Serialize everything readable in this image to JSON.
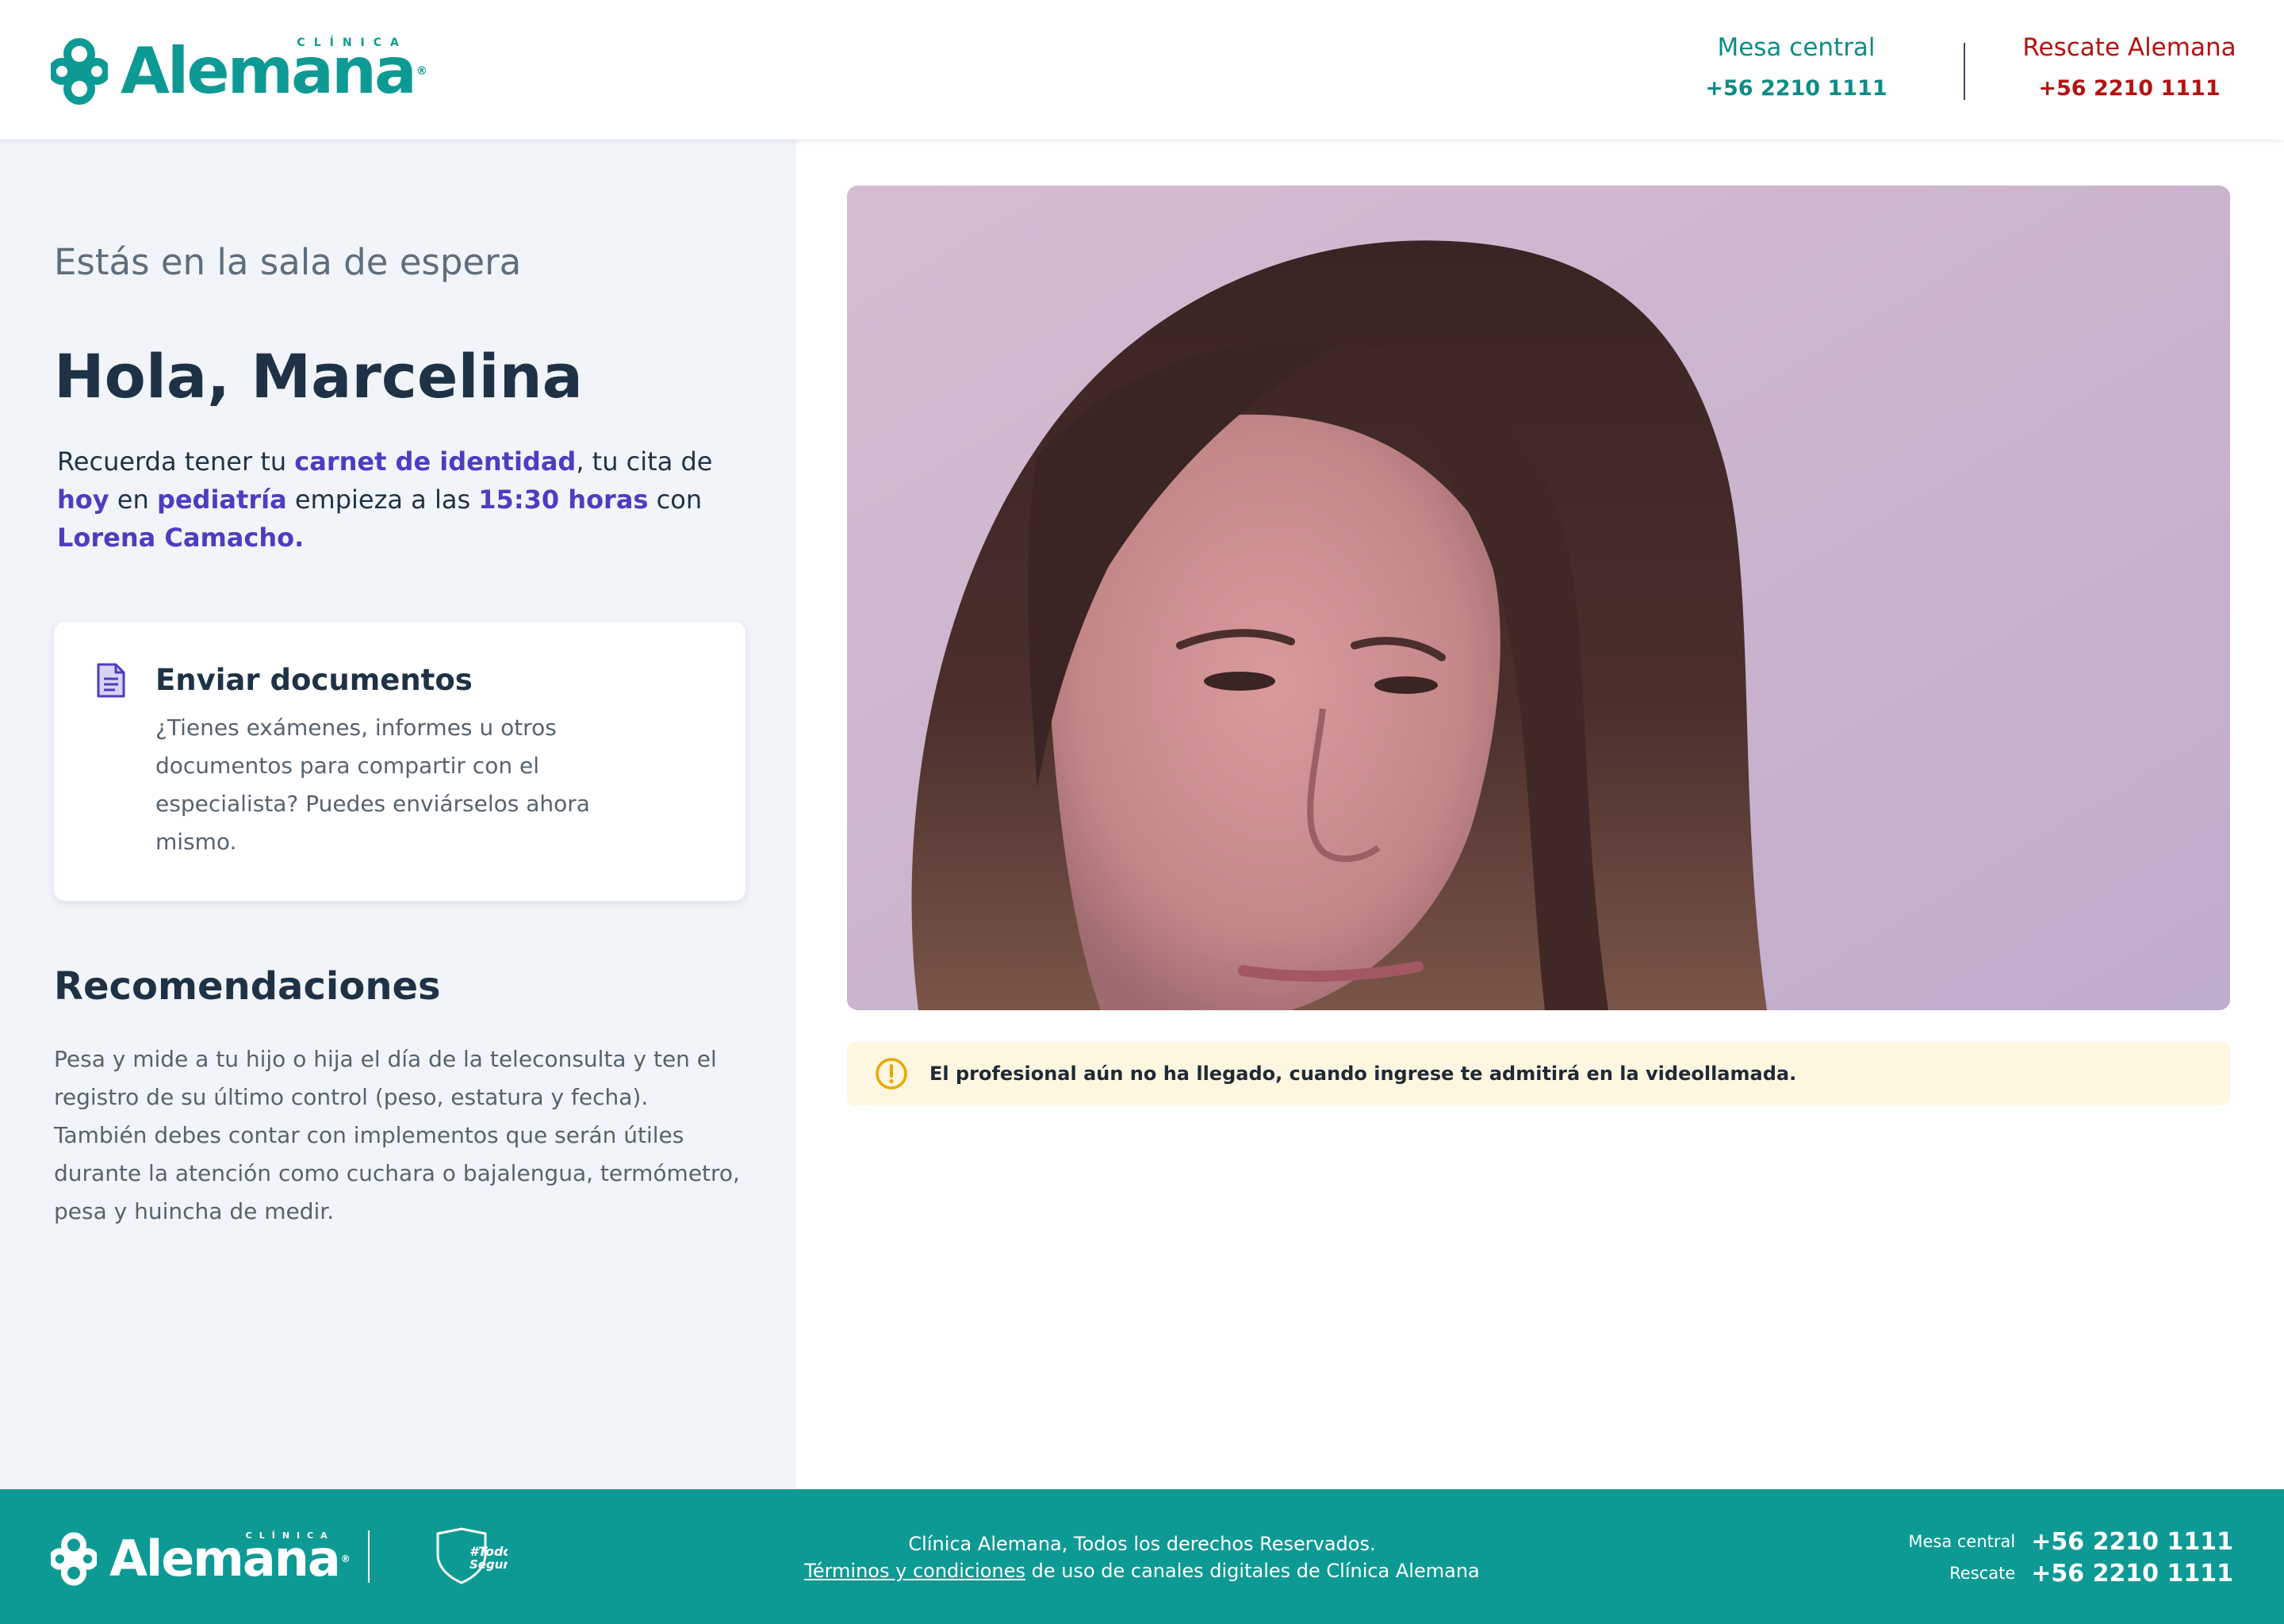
{
  "brand": {
    "name": "Alemana",
    "tagline": "CLÍNICA",
    "registered": "®",
    "teal": "#0e9a94",
    "red": "#b41212",
    "purple": "#4b3ec2"
  },
  "header": {
    "central_label": "Mesa central",
    "central_number": "+56 2210 1111",
    "rescue_label": "Rescate Alemana",
    "rescue_number": "+56 2210 1111"
  },
  "waiting_room": {
    "subtitle": "Estás en la sala de espera",
    "greeting": "Hola, Marcelina",
    "reminder": {
      "p1": "Recuerda tener tu ",
      "document": "carnet de identidad",
      "p2": ", tu cita de ",
      "day": "hoy",
      "p3": " en ",
      "specialty": "pediatría",
      "p4": " empieza a las ",
      "time": "15:30 horas",
      "p5": " con ",
      "doctor": "Lorena Camacho."
    }
  },
  "documents_card": {
    "icon": "document-icon",
    "title": "Enviar documentos",
    "description": "¿Tienes exámenes, informes u otros documentos para compartir con el especialista? Puedes enviárselos ahora mismo."
  },
  "recommendations": {
    "title": "Recomendaciones",
    "text": "Pesa y mide a tu hijo o hija el día de la teleconsulta y ten el registro de su último control (peso, estatura y fecha). También debes contar con implementos que serán útiles durante la atención como cuchara o bajalengua, termómetro, pesa y huincha de medir."
  },
  "video": {
    "icon": "camera-feed"
  },
  "notice": {
    "icon": "warning-circle-icon",
    "text": "El profesional aún no ha llegado, cuando ingrese te admitirá en la videollamada."
  },
  "footer": {
    "badge_line1": "#Todos",
    "badge_line2": "Seguros",
    "rights": "Clínica Alemana, Todos los derechos Reservados.",
    "terms_link": "Términos y condiciones",
    "terms_rest": " de uso de canales digitales de Clínica Alemana",
    "central_label": "Mesa central",
    "central_number": "+56 2210 1111",
    "rescue_label": "Rescate",
    "rescue_number": "+56 2210 1111"
  }
}
